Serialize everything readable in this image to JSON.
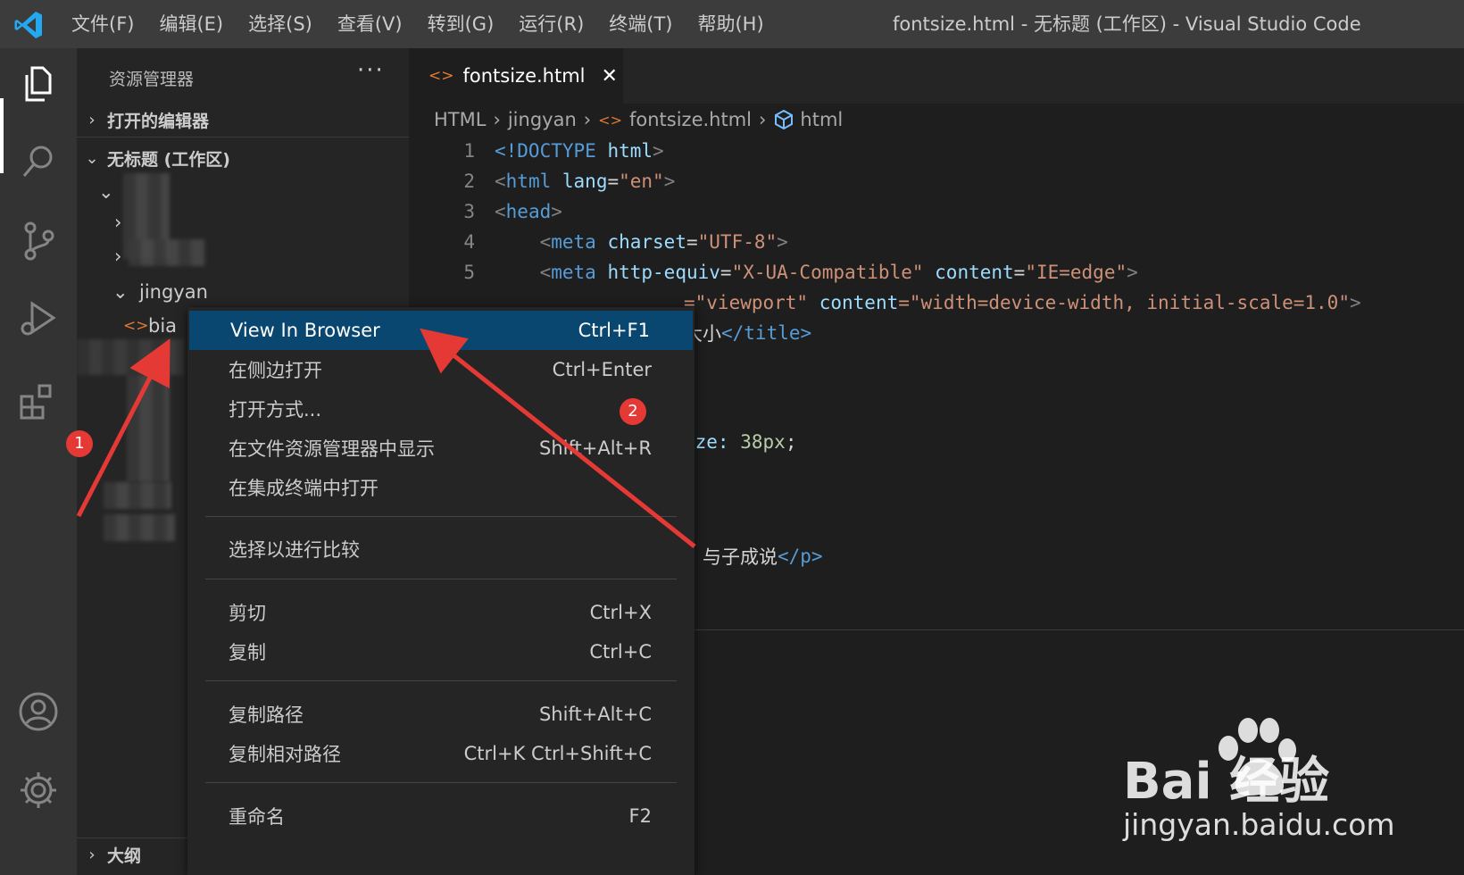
{
  "window": {
    "title": "fontsize.html - 无标题 (工作区) - Visual Studio Code"
  },
  "menubar": {
    "items": [
      "文件(F)",
      "编辑(E)",
      "选择(S)",
      "查看(V)",
      "转到(G)",
      "运行(R)",
      "终端(T)",
      "帮助(H)"
    ]
  },
  "activitybar": {
    "icons": [
      "explorer-icon",
      "search-icon",
      "source-control-icon",
      "run-debug-icon",
      "extensions-icon",
      "account-icon",
      "settings-gear-icon"
    ]
  },
  "sidebar": {
    "title": "资源管理器",
    "more": "···",
    "open_editors": "打开的编辑器",
    "workspace": "无标题 (工作区)",
    "folder": "jingyan",
    "file_partial": "bia",
    "outline": "大纲"
  },
  "editor": {
    "tab": {
      "name": "fontsize.html",
      "close": "✕"
    },
    "breadcrumb": [
      "HTML",
      "jingyan",
      "fontsize.html",
      "html"
    ],
    "lines": [
      {
        "n": "1",
        "doctype": "<!DOCTYPE",
        "doctype_name": "html",
        "close": ">"
      },
      {
        "n": "2",
        "tag": "html",
        "attr": "lang",
        "value": "\"en\""
      },
      {
        "n": "3",
        "tag": "head"
      },
      {
        "n": "4",
        "tag": "meta",
        "attr": "charset",
        "value": "\"UTF-8\""
      },
      {
        "n": "5",
        "tag": "meta",
        "attr": "http-equiv",
        "value": "\"X-UA-Compatible\"",
        "attr2": "content",
        "value2": "\"IE=edge\""
      }
    ],
    "visible_fragments": {
      "line6_value": "=\"viewport\"",
      "line6_attr2": "content",
      "line6_value2": "=\"width=device-width, initial-scale=1.0\"",
      "line6_end": ">",
      "line7_text": "大小",
      "line7_close": "</title>",
      "style_prop": "ize:",
      "style_value": "38px",
      "style_end": ";",
      "para_text": "，与子成说",
      "para_close": "</p>"
    }
  },
  "context_menu": {
    "items": [
      {
        "label": "View In Browser",
        "kbd": "Ctrl+F1",
        "selected": true
      },
      {
        "label": "在侧边打开",
        "kbd": "Ctrl+Enter"
      },
      {
        "label": "打开方式...",
        "kbd": ""
      },
      {
        "label": "在文件资源管理器中显示",
        "kbd": "Shift+Alt+R"
      },
      {
        "label": "在集成终端中打开",
        "kbd": ""
      },
      {
        "label": "选择以进行比较",
        "kbd": ""
      },
      {
        "label": "剪切",
        "kbd": "Ctrl+X"
      },
      {
        "label": "复制",
        "kbd": "Ctrl+C"
      },
      {
        "label": "复制路径",
        "kbd": "Shift+Alt+C"
      },
      {
        "label": "复制相对路径",
        "kbd": "Ctrl+K Ctrl+Shift+C"
      },
      {
        "label": "重命名",
        "kbd": "F2"
      }
    ]
  },
  "annotations": {
    "badge1": "1",
    "badge2": "2"
  },
  "watermark": {
    "brand": "Bai  经验",
    "url": "jingyan.baidu.com"
  },
  "colors": {
    "accent": "#094771",
    "file_icon": "#e37933",
    "annotation": "#e53935"
  }
}
